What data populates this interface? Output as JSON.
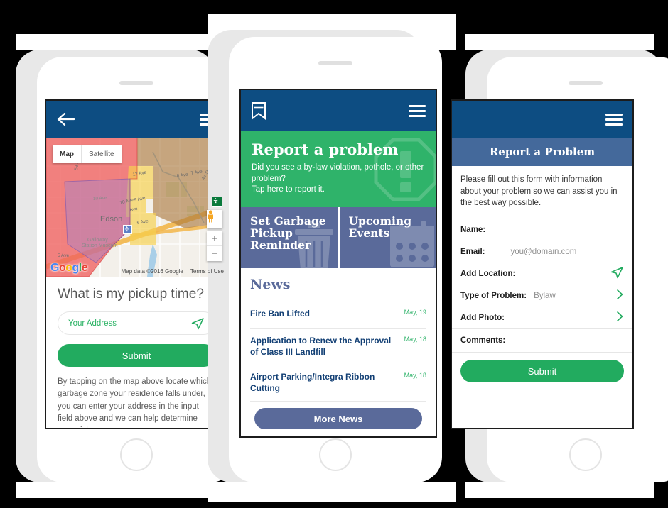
{
  "left_phone": {
    "appbar": {
      "back_icon": "back-arrow-icon",
      "menu_icon": "hamburger-menu-icon"
    },
    "map": {
      "map_button": "Map",
      "satellite_button": "Satellite",
      "zoom_in": "+",
      "zoom_out": "−",
      "city_label": "Edson",
      "poi_label": "Galloway Station Museum",
      "street_labels": [
        "12 Ave",
        "10 Ave",
        "9 Ave",
        "8 Ave",
        "7 Ave",
        "6 Ave",
        "5 Ave",
        "42 St"
      ],
      "google_logo": [
        "G",
        "o",
        "o",
        "g",
        "l",
        "e"
      ],
      "attribution": "Map data ©2016 Google",
      "terms": "Terms of Use",
      "zone_colors": {
        "red": "#f0605f",
        "purple": "#bbaedd",
        "yellow": "#fbe08a",
        "brown": "#b08a5c"
      }
    },
    "pickup": {
      "title": "What is my pickup time?",
      "address_placeholder": "Your Address",
      "locate_icon": "location-arrow-icon",
      "submit_label": "Submit",
      "help_text": "By tapping on the map above locate which garbage zone your residence falls under, or you can enter your address in the input field above and we can help determine your pickup zone."
    }
  },
  "middle_phone": {
    "appbar": {
      "bookmark_icon": "bookmark-icon",
      "menu_icon": "hamburger-menu-icon"
    },
    "hero": {
      "title": "Report a problem",
      "subtitle": "Did you see a by-law violation, pothole, or other problem?\nTap here to report it.",
      "watermark_icon": "exclamation-stop-sign-icon",
      "bg_color": "#2fb36a"
    },
    "tiles": [
      {
        "label": "Set Garbage Pickup Reminder",
        "watermark_icon": "garbage-can-icon"
      },
      {
        "label": "Upcoming Events",
        "watermark_icon": "calendar-icon"
      }
    ],
    "news": {
      "heading": "News",
      "items": [
        {
          "title": "Fire Ban Lifted",
          "date": "May, 19"
        },
        {
          "title": "Application to Renew the Approval of Class III Landfill",
          "date": "May, 18"
        },
        {
          "title": "Airport Parking/Integra Ribbon Cutting",
          "date": "May, 18"
        }
      ],
      "more_label": "More News"
    }
  },
  "right_phone": {
    "appbar": {
      "menu_icon": "hamburger-menu-icon"
    },
    "form": {
      "title": "Report a Problem",
      "intro": "Please fill out this form with information about your problem so we can assist you in the best way possible.",
      "rows": [
        {
          "label": "Name:",
          "value": "",
          "control": "text"
        },
        {
          "label": "Email:",
          "value": "you@domain.com",
          "control": "text"
        },
        {
          "label": "Add Location:",
          "value": "",
          "control": "location-arrow-icon"
        },
        {
          "label": "Type of Problem:",
          "value": "Bylaw",
          "control": "chevron-right-icon"
        },
        {
          "label": "Add Photo:",
          "value": "",
          "control": "chevron-right-icon"
        },
        {
          "label": "Comments:",
          "value": "",
          "control": "text"
        }
      ],
      "submit_label": "Submit"
    }
  },
  "theme": {
    "navy": "#0d4d82",
    "green": "#22ab5f",
    "slate": "#5a6a9a",
    "header_blue": "#44699b"
  }
}
